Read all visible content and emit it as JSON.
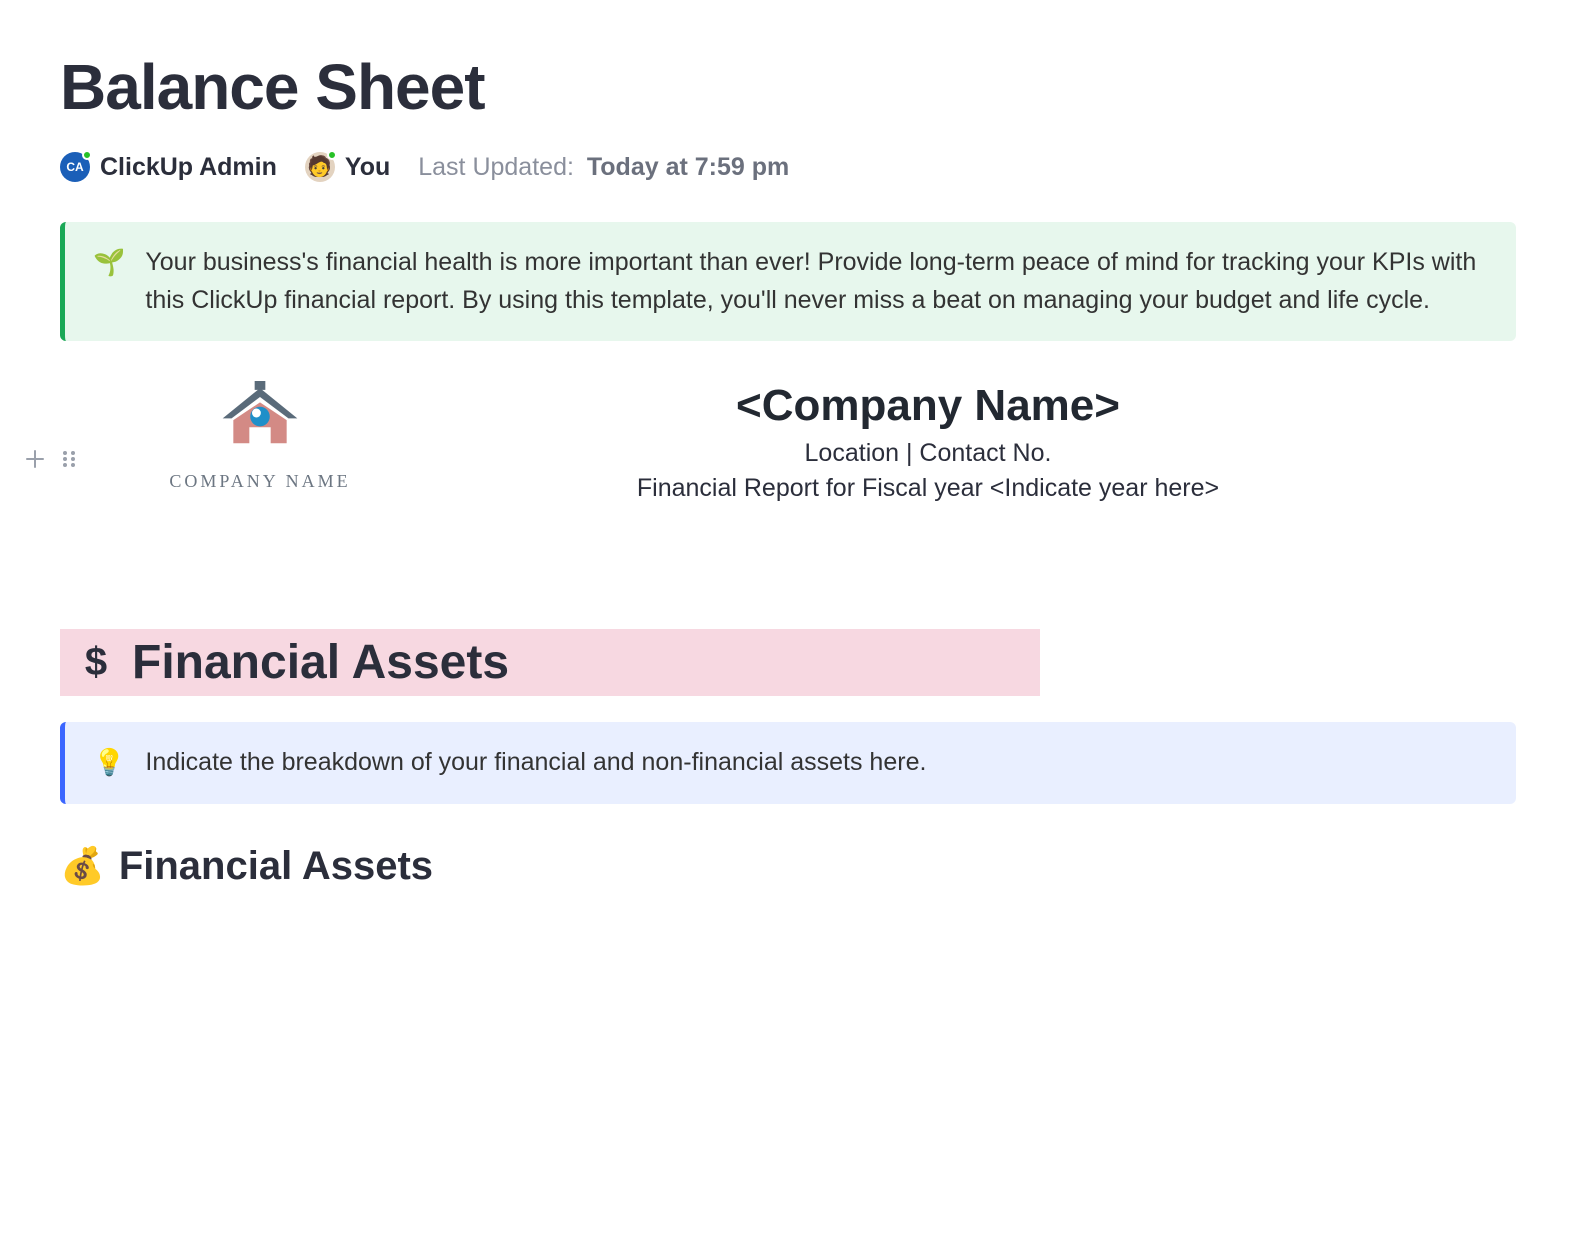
{
  "page": {
    "title": "Balance Sheet"
  },
  "meta": {
    "user1": {
      "initials": "CA",
      "name": "ClickUp Admin"
    },
    "user2": {
      "name": "You"
    },
    "last_updated_label": "Last Updated:",
    "last_updated_value": "Today at 7:59 pm"
  },
  "intro_callout": {
    "emoji": "🌱",
    "text": "Your business's financial health is more important than ever! Provide long-term peace of mind for tracking your KPIs with this ClickUp financial report. By using this template, you'll never miss a beat on managing your budget and life cycle."
  },
  "company": {
    "logo_label": "COMPANY NAME",
    "name": "<Company Name>",
    "location_contact": "Location | Contact No.",
    "report_line": "Financial Report for Fiscal year <Indicate year here>"
  },
  "section1": {
    "title": "Financial Assets",
    "tip_emoji": "💡",
    "tip_text": "Indicate the breakdown of your financial and non-financial assets here."
  },
  "subsection": {
    "emoji": "💰",
    "title": "Financial Assets"
  }
}
